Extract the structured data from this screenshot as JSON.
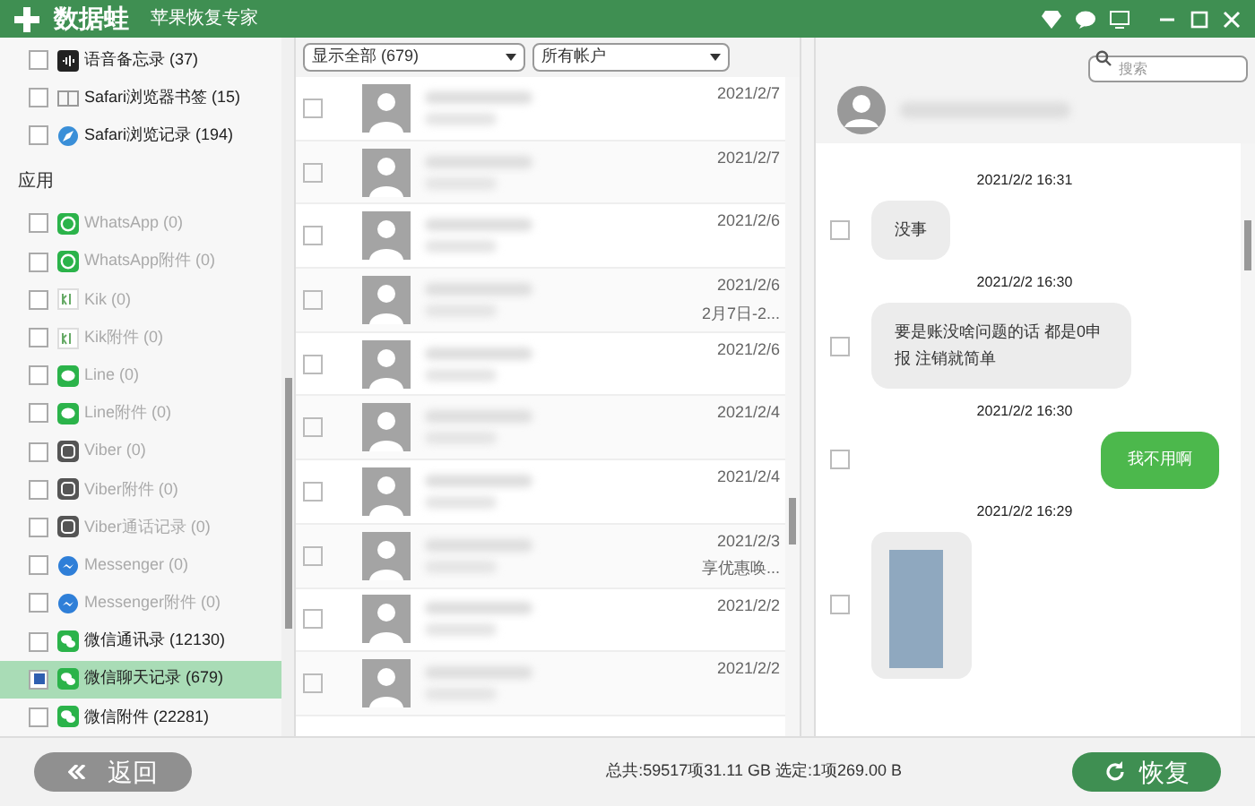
{
  "window": {
    "logo_text": "数据蛙",
    "subtitle": "苹果恢复专家"
  },
  "sidebar": {
    "items": [
      {
        "kind": "item",
        "label": "语音备忘录 (37)",
        "checked": false,
        "disabled": false,
        "selected": false
      },
      {
        "kind": "item",
        "label": "Safari浏览器书签 (15)",
        "checked": false,
        "disabled": false,
        "selected": false
      },
      {
        "kind": "item",
        "label": "Safari浏览记录 (194)",
        "checked": false,
        "disabled": false,
        "selected": false
      },
      {
        "kind": "header",
        "label": "应用"
      },
      {
        "kind": "item",
        "label": "WhatsApp (0)",
        "checked": false,
        "disabled": true,
        "selected": false
      },
      {
        "kind": "item",
        "label": "WhatsApp附件 (0)",
        "checked": false,
        "disabled": true,
        "selected": false
      },
      {
        "kind": "item",
        "label": "Kik (0)",
        "checked": false,
        "disabled": true,
        "selected": false
      },
      {
        "kind": "item",
        "label": "Kik附件 (0)",
        "checked": false,
        "disabled": true,
        "selected": false
      },
      {
        "kind": "item",
        "label": "Line (0)",
        "checked": false,
        "disabled": true,
        "selected": false
      },
      {
        "kind": "item",
        "label": "Line附件 (0)",
        "checked": false,
        "disabled": true,
        "selected": false
      },
      {
        "kind": "item",
        "label": "Viber (0)",
        "checked": false,
        "disabled": true,
        "selected": false
      },
      {
        "kind": "item",
        "label": "Viber附件 (0)",
        "checked": false,
        "disabled": true,
        "selected": false
      },
      {
        "kind": "item",
        "label": "Viber通话记录 (0)",
        "checked": false,
        "disabled": true,
        "selected": false
      },
      {
        "kind": "item",
        "label": "Messenger (0)",
        "checked": false,
        "disabled": true,
        "selected": false
      },
      {
        "kind": "item",
        "label": "Messenger附件 (0)",
        "checked": false,
        "disabled": true,
        "selected": false
      },
      {
        "kind": "item",
        "label": "微信通讯录 (12130)",
        "checked": false,
        "disabled": false,
        "selected": false
      },
      {
        "kind": "item",
        "label": "微信聊天记录 (679)",
        "checked": true,
        "disabled": false,
        "selected": true
      },
      {
        "kind": "item",
        "label": "微信附件 (22281)",
        "checked": false,
        "disabled": false,
        "selected": false
      }
    ]
  },
  "filters": {
    "show": "显示全部 (679)",
    "account": "所有帐户"
  },
  "search": {
    "placeholder": "搜索"
  },
  "conversations": [
    {
      "date": "2021/2/7",
      "checked": false
    },
    {
      "date": "2021/2/7",
      "checked": false
    },
    {
      "date": "2021/2/6",
      "checked": false
    },
    {
      "date": "2021/2/6",
      "preview": "2月7日-2...",
      "checked": false
    },
    {
      "date": "2021/2/6",
      "checked": false
    },
    {
      "date": "2021/2/4",
      "checked": false
    },
    {
      "date": "2021/2/4",
      "checked": false
    },
    {
      "date": "2021/2/3",
      "preview": "享优惠唤...",
      "checked": false
    },
    {
      "date": "2021/2/2",
      "checked": false
    },
    {
      "date": "2021/2/2",
      "checked": false
    }
  ],
  "chat": {
    "messages": [
      {
        "time": "2021/2/2 16:31",
        "kind": "received",
        "text": "没事",
        "checked": false
      },
      {
        "time": "2021/2/2 16:30",
        "kind": "received",
        "text": "要是账没啥问题的话 都是0申报 注销就简单",
        "checked": false
      },
      {
        "time": "2021/2/2 16:30",
        "kind": "sent",
        "text": "我不用啊",
        "checked": false
      },
      {
        "time": "2021/2/2 16:29",
        "kind": "image",
        "checked": false
      }
    ]
  },
  "status_bar": {
    "summary": "总共:59517项31.11 GB 选定:1项269.00 B",
    "back_button": "返回",
    "recover_button": "恢复"
  }
}
